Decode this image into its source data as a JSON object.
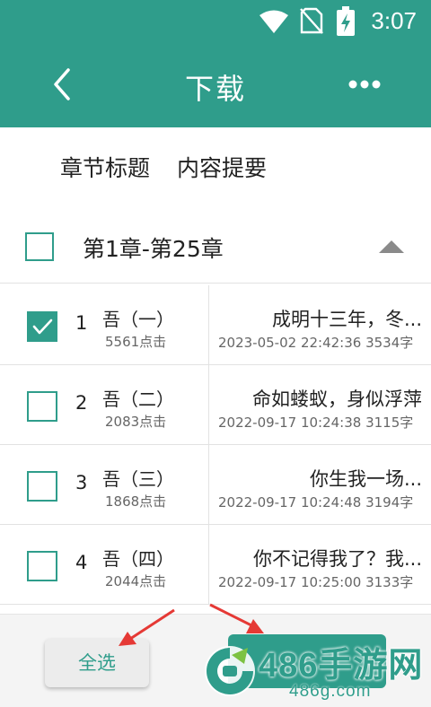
{
  "status_bar": {
    "time": "3:07",
    "icons": [
      "wifi-icon",
      "no-sim-icon",
      "battery-charging-icon"
    ]
  },
  "header": {
    "title": "下载",
    "back_icon": "chevron-left-icon",
    "more_icon": "more-dots-icon"
  },
  "tabs": [
    {
      "label": "章节标题"
    },
    {
      "label": "内容提要"
    }
  ],
  "group": {
    "label": "第1章-第25章",
    "checked": false,
    "collapse_icon": "triangle-up-icon"
  },
  "chapters": [
    {
      "num": "1",
      "name": "吾（一）",
      "clicks": "5561点击",
      "excerpt": "成明十三年，冬...",
      "datetime": "2023-05-02 22:42:36",
      "words": "3534字",
      "checked": true
    },
    {
      "num": "2",
      "name": "吾（二）",
      "clicks": "2083点击",
      "excerpt": "命如蝼蚁，身似浮萍",
      "datetime": "2022-09-17 10:24:38",
      "words": "3115字",
      "checked": false
    },
    {
      "num": "3",
      "name": "吾（三）",
      "clicks": "1868点击",
      "excerpt": "你生我一场...",
      "datetime": "2022-09-17 10:24:48",
      "words": "3194字",
      "checked": false
    },
    {
      "num": "4",
      "name": "吾（四）",
      "clicks": "2044点击",
      "excerpt": "你不记得我了？我...",
      "datetime": "2022-09-17 10:25:00",
      "words": "3133字",
      "checked": false
    }
  ],
  "bottom_bar": {
    "select_all_label": "全选"
  },
  "watermark": {
    "brand": "486手游网",
    "url": "486g.com"
  },
  "colors": {
    "primary": "#2f9d8b",
    "arrow": "#e53935",
    "text": "#222222",
    "muted": "#666666"
  }
}
